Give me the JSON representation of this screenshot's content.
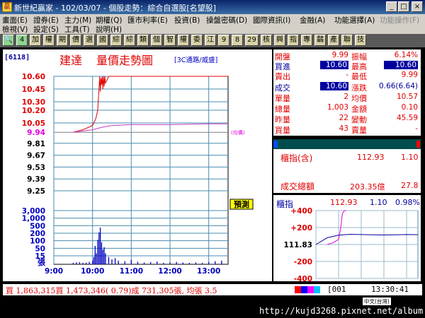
{
  "window": {
    "title": "新世紀贏家 - 102/03/07 - 個股走勢：綜合自選股[名望股]",
    "controls": [
      "_",
      "□",
      "×"
    ]
  },
  "menu": {
    "row1": [
      "畫面(E)",
      "證券(E)",
      "主力(M)",
      "期權(Q)",
      "匯市利率(E)",
      "投資(B)",
      "操盤密碼(D)",
      "國際資訊(I)",
      "金融(A)",
      "功能選擇(A)",
      "功能操作(F)"
    ],
    "row2": [
      "檢視(V)",
      "設定(S)",
      "工具(T)",
      "說明(H)"
    ]
  },
  "toolbar": [
    "🔍",
    "4",
    "加",
    "權",
    "期",
    "價",
    "選",
    "國",
    "綜",
    "綜",
    "類",
    "個",
    "智",
    "權",
    "委",
    "江",
    "9",
    "8",
    "29",
    "核",
    "興",
    "指",
    "專",
    "鷸",
    "產",
    "聯",
    "技"
  ],
  "stock": {
    "code": "6118",
    "name": "建達",
    "title": "量價走勢圖",
    "category": "3C通路/威盛"
  },
  "chart_data": [
    {
      "type": "line",
      "title": "量價走勢圖",
      "x_ticks": [
        "9:00",
        "10:00",
        "11:00",
        "12:00",
        "13:00"
      ],
      "price_ticks": [
        10.6,
        10.45,
        10.3,
        10.2,
        10.05,
        9.94,
        9.81,
        9.67,
        9.53,
        9.39,
        9.25
      ],
      "ylim": [
        9.25,
        10.6
      ],
      "reference_price": 9.94,
      "limit_up": 10.6,
      "avg_label": "(均價)",
      "series": [
        {
          "name": "price",
          "color": "#e00000",
          "x": [
            "9:30",
            "9:45",
            "10:00",
            "10:05",
            "10:08",
            "10:10",
            "10:11",
            "10:12",
            "10:13",
            "10:14",
            "10:15",
            "10:16",
            "10:17",
            "10:18",
            "10:19",
            "10:20",
            "10:25",
            "10:30",
            "10:35",
            "10:40",
            "13:30"
          ],
          "y": [
            9.94,
            9.97,
            10.02,
            10.1,
            10.2,
            10.45,
            10.6,
            10.42,
            10.58,
            10.5,
            10.6,
            10.45,
            10.6,
            10.48,
            10.6,
            10.52,
            10.6,
            10.6,
            10.6,
            10.6,
            10.6
          ]
        },
        {
          "name": "average",
          "color": "#c040c0",
          "x": [
            "9:30",
            "10:00",
            "10:15",
            "10:30",
            "11:00",
            "12:00",
            "13:00",
            "13:30"
          ],
          "y": [
            9.94,
            9.97,
            10.0,
            10.02,
            10.03,
            10.03,
            10.04,
            10.04
          ]
        }
      ]
    },
    {
      "type": "bar",
      "title": "volume",
      "y_ticks": [
        "3,000",
        "1,000",
        "500",
        "200",
        "100",
        "50",
        "15"
      ],
      "unit": "張",
      "predict_label": "預測",
      "x": [
        "9:30",
        "9:35",
        "9:40",
        "9:45",
        "9:50",
        "9:55",
        "10:00",
        "10:02",
        "10:04",
        "10:06",
        "10:08",
        "10:10",
        "10:12",
        "10:14",
        "10:16",
        "10:18",
        "10:20",
        "10:25",
        "10:30",
        "10:35",
        "10:40",
        "10:50",
        "11:00",
        "11:10",
        "11:20",
        "11:30",
        "11:40",
        "11:50",
        "12:00",
        "12:10",
        "12:20",
        "12:30",
        "12:40",
        "12:50",
        "13:00",
        "13:10",
        "13:20"
      ],
      "values": [
        12,
        15,
        18,
        10,
        14,
        20,
        30,
        60,
        150,
        90,
        200,
        260,
        300,
        180,
        120,
        140,
        90,
        60,
        40,
        50,
        30,
        25,
        35,
        20,
        15,
        18,
        22,
        12,
        16,
        20,
        14,
        10,
        15,
        12,
        18,
        25,
        30
      ]
    },
    {
      "type": "line",
      "title": "櫃指",
      "x_ticks": [
        "9:00",
        "10:00",
        "11:00",
        "12:00",
        "13:00"
      ],
      "y_ticks": [
        "+400",
        "+200",
        "111.83",
        "-200",
        "-400"
      ],
      "ylim": [
        -400,
        400
      ],
      "series": [
        {
          "name": "index",
          "color": "#0000a0",
          "x": [
            "9:00",
            "9:30",
            "10:00",
            "10:30",
            "11:00",
            "11:30",
            "12:00",
            "12:30",
            "13:00",
            "13:30"
          ],
          "y": [
            0,
            80,
            110,
            120,
            118,
            115,
            112,
            115,
            118,
            116
          ]
        },
        {
          "name": "stock",
          "color": "#e000e0",
          "x": [
            "9:30",
            "9:45",
            "10:00",
            "10:05",
            "10:10",
            "10:15",
            "10:20"
          ],
          "y": [
            0,
            20,
            60,
            180,
            360,
            400,
            400
          ]
        }
      ]
    }
  ],
  "quote": {
    "rows": [
      {
        "l1": "開盤",
        "v1": "9.99",
        "l2": "振幅",
        "v2": "6.14%"
      },
      {
        "l1": "買進",
        "v1": "10.60",
        "l2": "最高",
        "v2": "10.60"
      },
      {
        "l1": "賣出",
        "v1": "-",
        "l2": "最低",
        "v2": "9.99"
      },
      {
        "l1": "成交",
        "v1": "10.60",
        "l2": "漲跌",
        "v2": "0.66(6.64)"
      },
      {
        "l1": "單量",
        "v1": "2",
        "l2": "均價",
        "v2": "10.57"
      },
      {
        "l1": "總量",
        "v1": "1,003",
        "l2": "金額",
        "v2": "0.10"
      },
      {
        "l1": "昨量",
        "v1": "22",
        "l2": "變動",
        "v2": "45.59"
      },
      {
        "l1": "買量",
        "v1": "43",
        "l2": "賣量",
        "v2": "-"
      }
    ]
  },
  "otc_index": {
    "label": "櫃指(含)",
    "value": "112.93",
    "change": "1.10",
    "turnover_label": "成交總額",
    "turnover": "203.35億",
    "turnover_pct": "27.8"
  },
  "mini": {
    "label": "櫃指",
    "value": "112.93",
    "change": "1.10",
    "pct": "0.98%"
  },
  "status": {
    "text": "買 1,863,315買 1,473,346( 0.79)成 731,305張, 均張 3.5",
    "code": "[001",
    "time": "13:30:41"
  },
  "footer": {
    "ime_hint": "中文(台灣)",
    "url": "http://kujd3268.pixnet.net/album"
  }
}
